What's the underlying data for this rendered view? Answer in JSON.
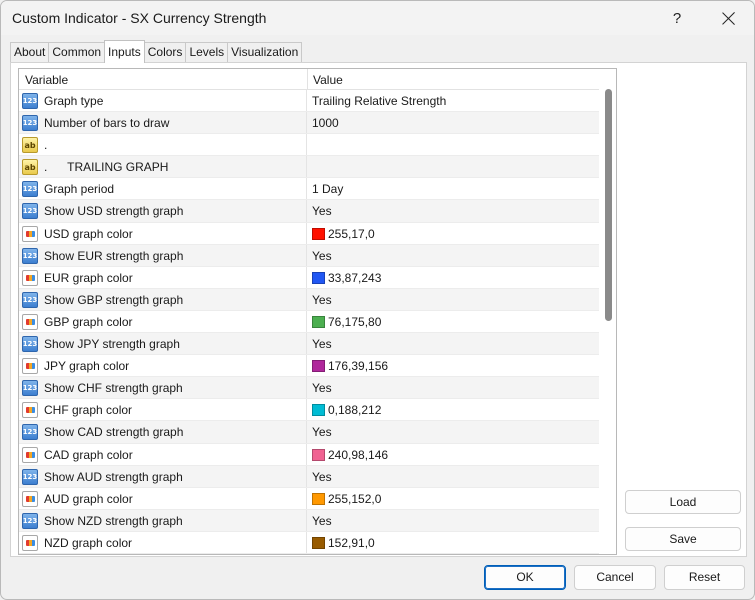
{
  "window": {
    "title": "Custom Indicator - SX Currency Strength",
    "help_glyph": "?"
  },
  "tabs": [
    {
      "label": "About"
    },
    {
      "label": "Common"
    },
    {
      "label": "Inputs"
    },
    {
      "label": "Colors"
    },
    {
      "label": "Levels"
    },
    {
      "label": "Visualization"
    }
  ],
  "active_tab": "Inputs",
  "grid": {
    "header_variable": "Variable",
    "header_value": "Value",
    "rows": [
      {
        "type": "num",
        "icon_text": "123",
        "variable": "Graph type",
        "value": "Trailing Relative Strength"
      },
      {
        "type": "num",
        "icon_text": "123",
        "variable": "Number of bars to draw",
        "value": "1000"
      },
      {
        "type": "txt",
        "icon_text": "ab",
        "variable": ".",
        "value": ""
      },
      {
        "type": "txt",
        "icon_text": "ab",
        "variable": ".      TRAILING GRAPH",
        "value": ""
      },
      {
        "type": "num",
        "icon_text": "123",
        "variable": "Graph period",
        "value": "1 Day"
      },
      {
        "type": "num",
        "icon_text": "123",
        "variable": "Show USD strength graph",
        "value": "Yes"
      },
      {
        "type": "col",
        "icon_text": "",
        "variable": "USD graph color",
        "value": "255,17,0",
        "swatch": "#ff1100"
      },
      {
        "type": "num",
        "icon_text": "123",
        "variable": "Show EUR strength graph",
        "value": "Yes"
      },
      {
        "type": "col",
        "icon_text": "",
        "variable": "EUR graph color",
        "value": "33,87,243",
        "swatch": "#2157f3"
      },
      {
        "type": "num",
        "icon_text": "123",
        "variable": "Show GBP strength graph",
        "value": "Yes"
      },
      {
        "type": "col",
        "icon_text": "",
        "variable": "GBP graph color",
        "value": "76,175,80",
        "swatch": "#4caf50"
      },
      {
        "type": "num",
        "icon_text": "123",
        "variable": "Show JPY strength graph",
        "value": "Yes"
      },
      {
        "type": "col",
        "icon_text": "",
        "variable": "JPY graph color",
        "value": "176,39,156",
        "swatch": "#b0279c"
      },
      {
        "type": "num",
        "icon_text": "123",
        "variable": "Show CHF strength graph",
        "value": "Yes"
      },
      {
        "type": "col",
        "icon_text": "",
        "variable": "CHF graph color",
        "value": "0,188,212",
        "swatch": "#00bcd4"
      },
      {
        "type": "num",
        "icon_text": "123",
        "variable": "Show CAD strength graph",
        "value": "Yes"
      },
      {
        "type": "col",
        "icon_text": "",
        "variable": "CAD graph color",
        "value": "240,98,146",
        "swatch": "#f06292"
      },
      {
        "type": "num",
        "icon_text": "123",
        "variable": "Show AUD strength graph",
        "value": "Yes"
      },
      {
        "type": "col",
        "icon_text": "",
        "variable": "AUD graph color",
        "value": "255,152,0",
        "swatch": "#ff9800"
      },
      {
        "type": "num",
        "icon_text": "123",
        "variable": "Show NZD strength graph",
        "value": "Yes"
      },
      {
        "type": "col",
        "icon_text": "",
        "variable": "NZD graph color",
        "value": "152,91,0",
        "swatch": "#985b00"
      }
    ]
  },
  "buttons": {
    "load": "Load",
    "save": "Save",
    "ok": "OK",
    "cancel": "Cancel",
    "reset": "Reset"
  }
}
